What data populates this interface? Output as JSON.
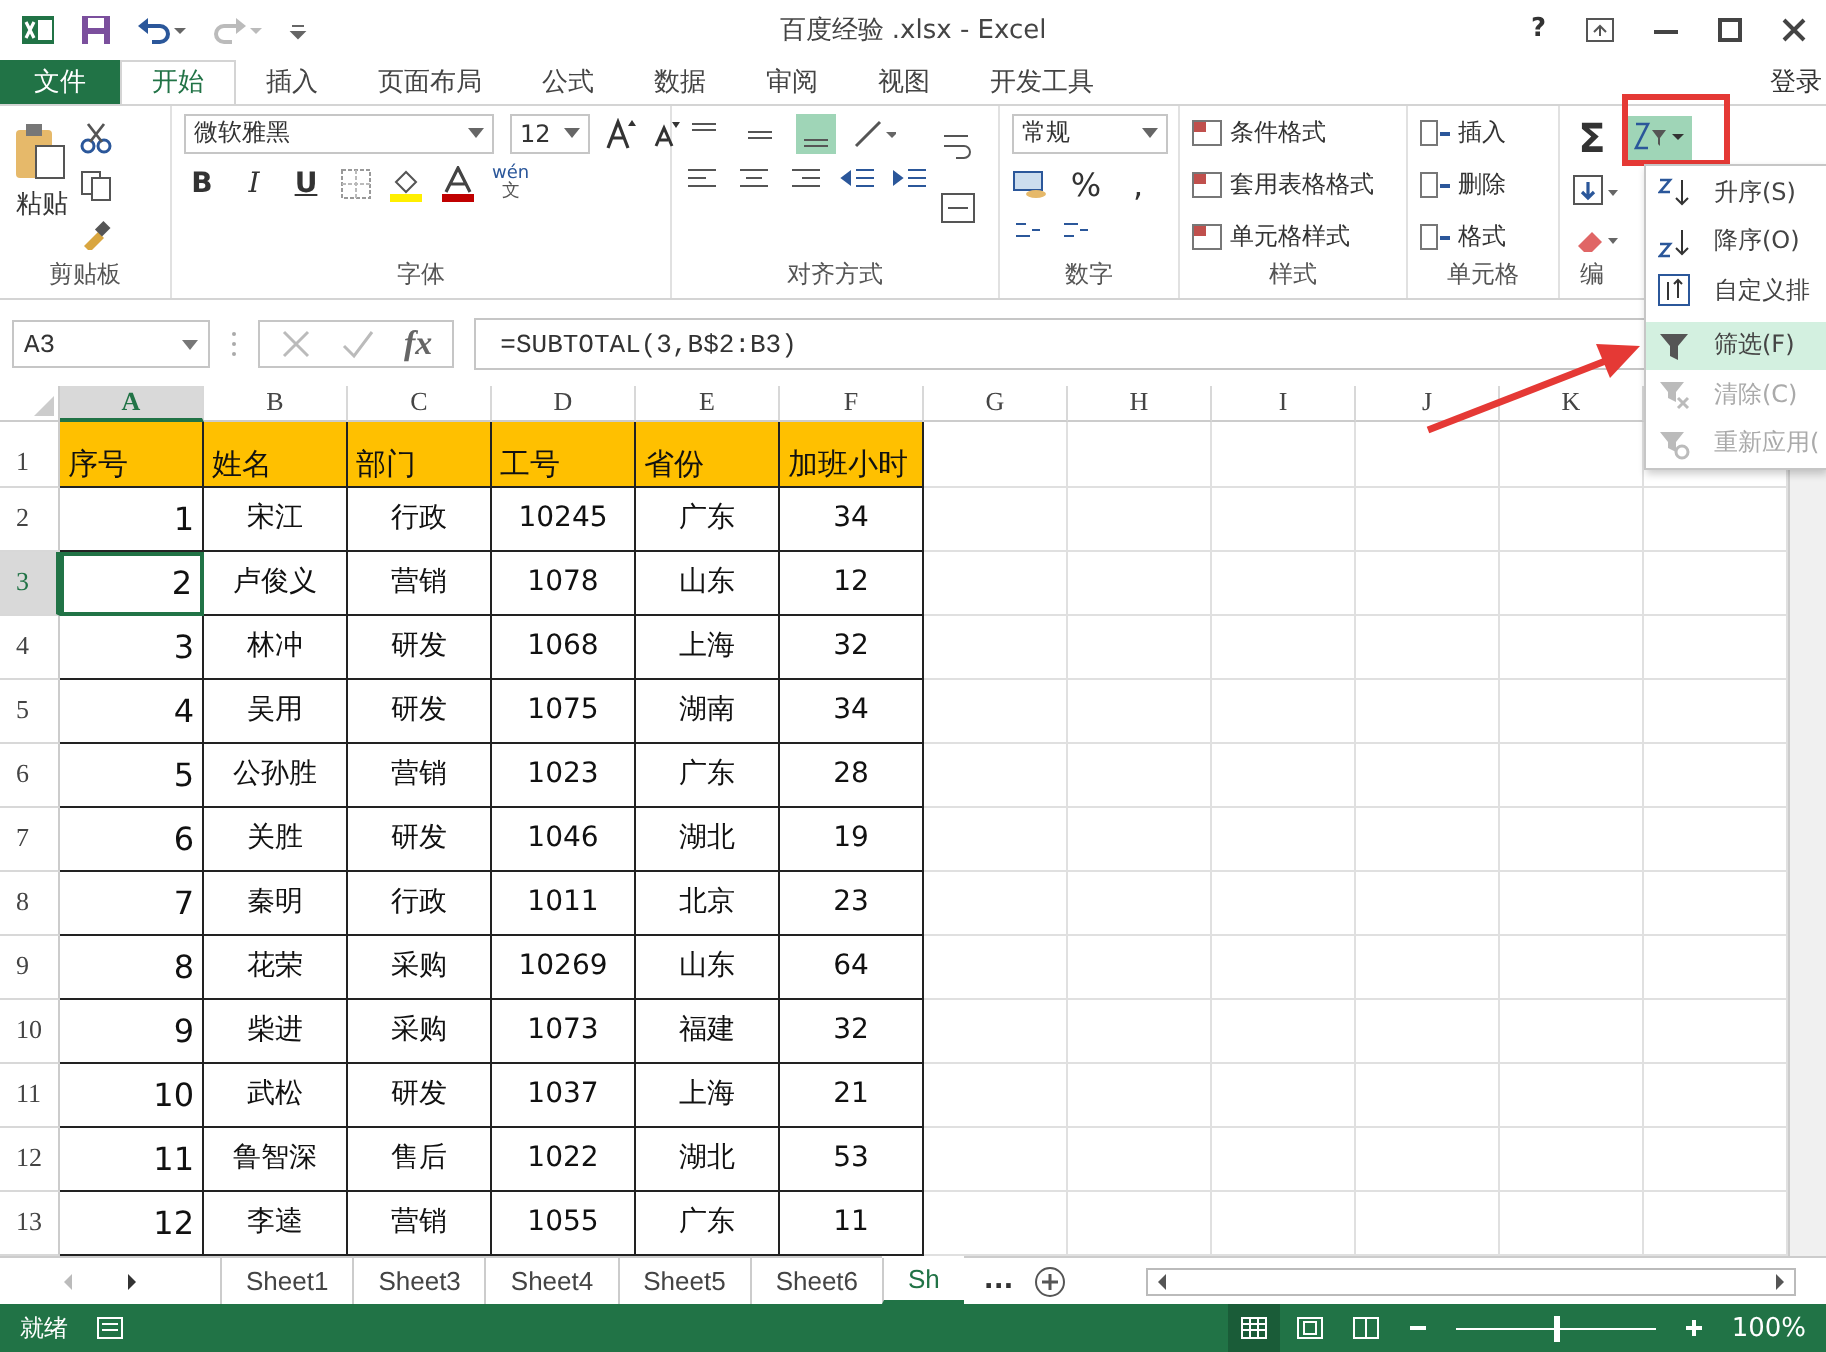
{
  "title_bar": {
    "title": "百度经验 .xlsx - Excel",
    "help": "?"
  },
  "ribbon_tabs": [
    {
      "label": "文件",
      "kind": "file",
      "selected": false
    },
    {
      "label": "开始",
      "kind": "tab",
      "selected": true
    },
    {
      "label": "插入",
      "kind": "tab",
      "selected": false
    },
    {
      "label": "页面布局",
      "kind": "tab",
      "selected": false
    },
    {
      "label": "公式",
      "kind": "tab",
      "selected": false
    },
    {
      "label": "数据",
      "kind": "tab",
      "selected": false
    },
    {
      "label": "审阅",
      "kind": "tab",
      "selected": false
    },
    {
      "label": "视图",
      "kind": "tab",
      "selected": false
    },
    {
      "label": "开发工具",
      "kind": "tab",
      "selected": false
    }
  ],
  "sign_in": "登录",
  "clipboard": {
    "paste": "粘贴",
    "label": "剪贴板"
  },
  "font": {
    "name": "微软雅黑",
    "size": "12",
    "bold": "B",
    "italic": "I",
    "underline": "U",
    "phonetic_top": "wén",
    "phonetic_bottom": "文",
    "label": "字体"
  },
  "alignment": {
    "label": "对齐方式"
  },
  "number": {
    "format": "常规",
    "percent": "%",
    "comma": ",",
    "label": "数字"
  },
  "styles": {
    "items": [
      "条件格式",
      "套用表格格式",
      "单元格样式"
    ],
    "label": "样式"
  },
  "cells": {
    "items": [
      "插入",
      "删除",
      "格式"
    ],
    "label": "单元格"
  },
  "editing": {
    "sum": "Σ",
    "label": "编",
    "sort_open": true
  },
  "formula_bar": {
    "name_box": "A3",
    "fx": "fx",
    "formula": "=SUBTOTAL(3,B$2:B3)"
  },
  "columns": [
    {
      "label": "A",
      "selected": true
    },
    {
      "label": "B",
      "selected": false
    },
    {
      "label": "C",
      "selected": false
    },
    {
      "label": "D",
      "selected": false
    },
    {
      "label": "E",
      "selected": false
    },
    {
      "label": "F",
      "selected": false
    },
    {
      "label": "G",
      "selected": false
    },
    {
      "label": "H",
      "selected": false
    },
    {
      "label": "I",
      "selected": false
    },
    {
      "label": "J",
      "selected": false
    },
    {
      "label": "K",
      "selected": false
    }
  ],
  "rows": [
    {
      "number": "1",
      "kind": "header",
      "selected": false,
      "cells": [
        "序号",
        "姓名",
        "部门",
        "工号",
        "省份",
        "加班小时"
      ]
    },
    {
      "number": "2",
      "kind": "data",
      "selected": false,
      "cells": [
        "1",
        "宋江",
        "行政",
        "10245",
        "广东",
        "34"
      ]
    },
    {
      "number": "3",
      "kind": "data",
      "selected": true,
      "cells": [
        "2",
        "卢俊义",
        "营销",
        "1078",
        "山东",
        "12"
      ]
    },
    {
      "number": "4",
      "kind": "data",
      "selected": false,
      "cells": [
        "3",
        "林冲",
        "研发",
        "1068",
        "上海",
        "32"
      ]
    },
    {
      "number": "5",
      "kind": "data",
      "selected": false,
      "cells": [
        "4",
        "吴用",
        "研发",
        "1075",
        "湖南",
        "34"
      ]
    },
    {
      "number": "6",
      "kind": "data",
      "selected": false,
      "cells": [
        "5",
        "公孙胜",
        "营销",
        "1023",
        "广东",
        "28"
      ]
    },
    {
      "number": "7",
      "kind": "data",
      "selected": false,
      "cells": [
        "6",
        "关胜",
        "研发",
        "1046",
        "湖北",
        "19"
      ]
    },
    {
      "number": "8",
      "kind": "data",
      "selected": false,
      "cells": [
        "7",
        "秦明",
        "行政",
        "1011",
        "北京",
        "23"
      ]
    },
    {
      "number": "9",
      "kind": "data",
      "selected": false,
      "cells": [
        "8",
        "花荣",
        "采购",
        "10269",
        "山东",
        "64"
      ]
    },
    {
      "number": "10",
      "kind": "data",
      "selected": false,
      "cells": [
        "9",
        "柴进",
        "采购",
        "1073",
        "福建",
        "32"
      ]
    },
    {
      "number": "11",
      "kind": "data",
      "selected": false,
      "cells": [
        "10",
        "武松",
        "研发",
        "1037",
        "上海",
        "21"
      ]
    },
    {
      "number": "12",
      "kind": "data",
      "selected": false,
      "cells": [
        "11",
        "鲁智深",
        "售后",
        "1022",
        "湖北",
        "53"
      ]
    },
    {
      "number": "13",
      "kind": "data",
      "selected": false,
      "cells": [
        "12",
        "李逵",
        "营销",
        "1055",
        "广东",
        "11"
      ]
    }
  ],
  "sort_menu": [
    {
      "label": "升序(S)",
      "kind": "asc",
      "selected": false,
      "disabled": false
    },
    {
      "label": "降序(O)",
      "kind": "desc",
      "selected": false,
      "disabled": false
    },
    {
      "label": "自定义排",
      "kind": "custom",
      "selected": false,
      "disabled": false
    },
    {
      "label": "筛选(F)",
      "kind": "filter",
      "selected": true,
      "disabled": false
    },
    {
      "label": "清除(C)",
      "kind": "clear",
      "selected": false,
      "disabled": true
    },
    {
      "label": "重新应用(",
      "kind": "reapply",
      "selected": false,
      "disabled": true
    }
  ],
  "sheet_tabs": [
    {
      "label": "Sheet1",
      "selected": false
    },
    {
      "label": "Sheet3",
      "selected": false
    },
    {
      "label": "Sheet4",
      "selected": false
    },
    {
      "label": "Sheet5",
      "selected": false
    },
    {
      "label": "Sheet6",
      "selected": false
    },
    {
      "label": "Sh",
      "selected": true
    }
  ],
  "more_sheets": "...",
  "status_bar": {
    "status": "就绪",
    "zoom": "100%",
    "zoom_level": {
      "level": 0.5
    }
  }
}
